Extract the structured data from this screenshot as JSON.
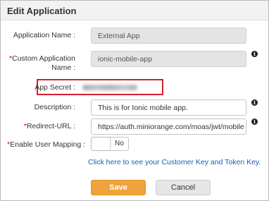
{
  "dialog": {
    "title": "Edit Application"
  },
  "form": {
    "application_name": {
      "label": "Application Name :",
      "value": "External App"
    },
    "custom_application_name": {
      "required_mark": "*",
      "label_line1": "Custom Application",
      "label_line2": "Name :",
      "value": "ionic-mobile-app"
    },
    "app_secret": {
      "label": "App Secret :"
    },
    "description": {
      "label": "Description :",
      "value": "This is for Ionic mobile app."
    },
    "redirect_url": {
      "required_mark": "*",
      "label": "Redirect-URL :",
      "value": "https://auth.miniorange.com/moas/jwt/mobile"
    },
    "enable_user_mapping": {
      "required_mark": "*",
      "label": "Enable User Mapping :",
      "toggle_text": "No"
    }
  },
  "link": {
    "text": "Click here to see your Customer Key and Token Key."
  },
  "buttons": {
    "save_label": "Save",
    "cancel_label": "Cancel"
  },
  "icons": {
    "info": "info-icon"
  },
  "colors": {
    "save_bg": "#f0a23c",
    "cancel_bg": "#e6e6e6",
    "highlight_border": "#d3212d",
    "link": "#1a5fb4",
    "required": "#d60000",
    "disabled_field": "#e4e4e4"
  }
}
